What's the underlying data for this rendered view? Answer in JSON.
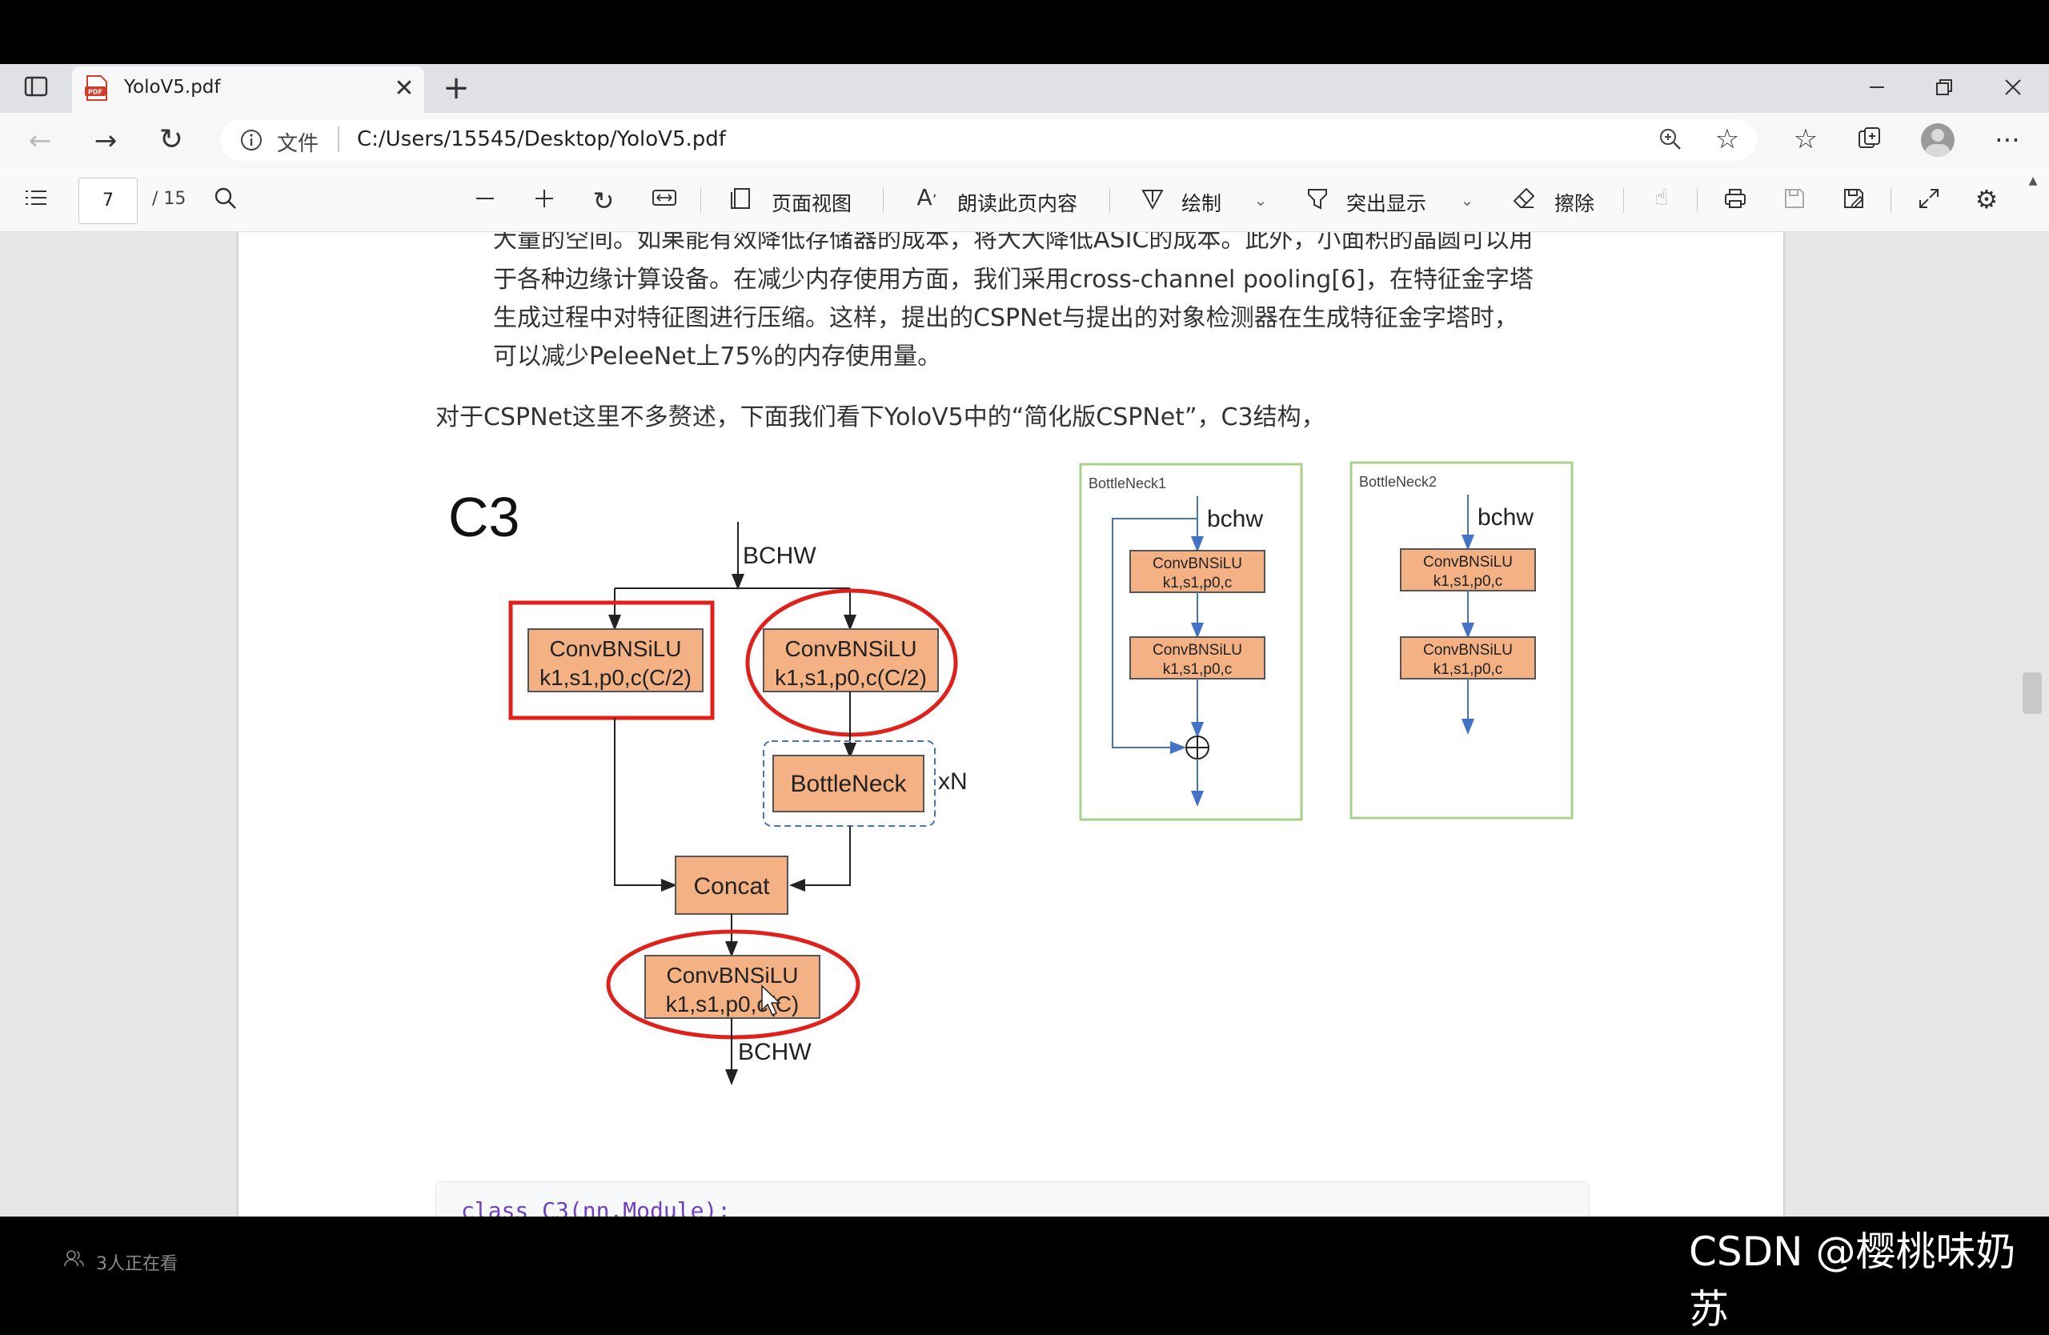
{
  "browser": {
    "tab_title": "YoloV5.pdf",
    "url_scheme_label": "文件",
    "url": "C:/Users/15545/Desktop/YoloV5.pdf"
  },
  "pdf_toolbar": {
    "current_page": "7",
    "total_pages": "/ 15",
    "page_view_label": "页面视图",
    "read_aloud_label": "朗读此页内容",
    "draw_label": "绘制",
    "highlight_label": "突出显示",
    "erase_label": "擦除"
  },
  "document": {
    "paragraph_lines": [
      "大量的空间。如果能有效降低存储器的成本，将大大降低ASIC的成本。此外，小面积的晶圆可以用",
      "于各种边缘计算设备。在减少内存使用方面，我们采用cross-channel pooling[6]，在特征金字塔",
      "生成过程中对特征图进行压缩。这样，提出的CSPNet与提出的对象检测器在生成特征金字塔时，",
      "可以减少PeleeNet上75%的内存使用量。"
    ],
    "intro_line": "对于CSPNet这里不多赘述，下面我们看下YoloV5中的“简化版CSPNet”，C3结构，",
    "code_line": "class C3(nn.Module):"
  },
  "diagram": {
    "title": "C3",
    "input_label": "BCHW",
    "output_label": "BCHW",
    "conv_left_line1": "ConvBNSiLU",
    "conv_left_line2": "k1,s1,p0,c(C/2)",
    "conv_right_line1": "ConvBNSiLU",
    "conv_right_line2": "k1,s1,p0,c(C/2)",
    "bottleneck_label": "BottleNeck",
    "repeat_label": "xN",
    "concat_label": "Concat",
    "conv_out_line1": "ConvBNSiLU",
    "conv_out_line2": "k1,s1,p0,c(C)",
    "bn1_title": "BottleNeck1",
    "bn1_input": "bchw",
    "bn1_conv1_line1": "ConvBNSiLU",
    "bn1_conv1_line2": "k1,s1,p0,c",
    "bn1_conv2_line1": "ConvBNSiLU",
    "bn1_conv2_line2": "k1,s1,p0,c",
    "bn2_title": "BottleNeck2",
    "bn2_input": "bchw",
    "bn2_conv1_line1": "ConvBNSiLU",
    "bn2_conv1_line2": "k1,s1,p0,c",
    "bn2_conv2_line1": "ConvBNSiLU",
    "bn2_conv2_line2": "k1,s1,p0,c"
  },
  "overlay": {
    "viewers": "3人正在看",
    "watermark": "CSDN @樱桃味奶苏"
  },
  "colors": {
    "block_fill": "#f4b183",
    "highlight_red": "#e0201b",
    "bottleneck_frame": "#a9d18e",
    "arrow_blue": "#4472c4"
  }
}
